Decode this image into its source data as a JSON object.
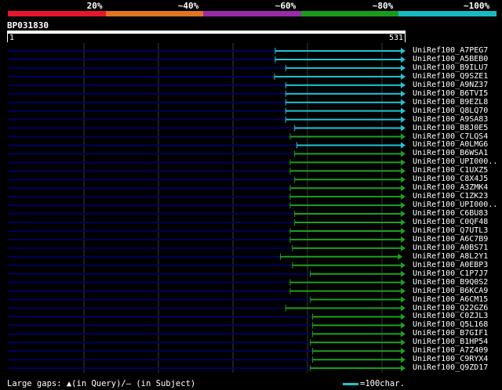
{
  "scale_legend": {
    "labels": [
      "20%",
      "~40%",
      "~60%",
      "~80%",
      "~100%"
    ],
    "colors": [
      "#e8162a",
      "#e07620",
      "#9a2aa8",
      "#1a9c1a",
      "#1ab8c4"
    ]
  },
  "query": {
    "name": "BP031830",
    "start": "1",
    "end": "531",
    "length": 531
  },
  "hits": [
    {
      "name": "UniRef100_A7PEG7",
      "start": 358,
      "end": 531,
      "color": "cyan",
      "kind": "arrow"
    },
    {
      "name": "UniRef100_A5BEB0",
      "start": 358,
      "end": 531,
      "color": "cyan",
      "kind": "arrow"
    },
    {
      "name": "UniRef100_B9ILU7",
      "start": 372,
      "end": 531,
      "color": "cyan",
      "kind": "arrow"
    },
    {
      "name": "UniRef100_Q9SZE1",
      "start": 357,
      "end": 531,
      "color": "cyan",
      "kind": "arrow"
    },
    {
      "name": "UniRef100_A9NZ37",
      "start": 372,
      "end": 531,
      "color": "cyan",
      "kind": "arrow"
    },
    {
      "name": "UniRef100_B6TVI5",
      "start": 372,
      "end": 531,
      "color": "cyan",
      "kind": "arrow"
    },
    {
      "name": "UniRef100_B9EZL8",
      "start": 372,
      "end": 531,
      "color": "cyan",
      "kind": "arrow"
    },
    {
      "name": "UniRef100_Q8LQ70",
      "start": 372,
      "end": 531,
      "color": "cyan",
      "kind": "arrow"
    },
    {
      "name": "UniRef100_A9SA83",
      "start": 372,
      "end": 531,
      "color": "cyan",
      "kind": "arrow"
    },
    {
      "name": "UniRef100_B8J0E5",
      "start": 384,
      "end": 531,
      "color": "cyan",
      "kind": "arrow"
    },
    {
      "name": "UniRef100_C7LQS4",
      "start": 378,
      "end": 531,
      "color": "green",
      "kind": "arrow"
    },
    {
      "name": "UniRef100_A0LMG6",
      "start": 387,
      "end": 531,
      "color": "cyan",
      "kind": "arrow"
    },
    {
      "name": "UniRef100_B6WSA1",
      "start": 384,
      "end": 531,
      "color": "green",
      "kind": "arrow"
    },
    {
      "name": "UniRef100_UPI000..",
      "start": 378,
      "end": 531,
      "color": "green",
      "kind": "arrow"
    },
    {
      "name": "UniRef100_C1UXZ5",
      "start": 378,
      "end": 531,
      "color": "green",
      "kind": "arrow"
    },
    {
      "name": "UniRef100_C8X4J5",
      "start": 384,
      "end": 531,
      "color": "green",
      "kind": "arrow"
    },
    {
      "name": "UniRef100_A3ZMK4",
      "start": 378,
      "end": 531,
      "color": "green",
      "kind": "arrow"
    },
    {
      "name": "UniRef100_C1ZK23",
      "start": 378,
      "end": 531,
      "color": "green",
      "kind": "arrow"
    },
    {
      "name": "UniRef100_UPI000..",
      "start": 378,
      "end": 531,
      "color": "green",
      "kind": "arrow"
    },
    {
      "name": "UniRef100_C6BU83",
      "start": 384,
      "end": 531,
      "color": "green",
      "kind": "arrow"
    },
    {
      "name": "UniRef100_C0QF48",
      "start": 384,
      "end": 531,
      "color": "green",
      "kind": "arrow"
    },
    {
      "name": "UniRef100_Q7UTL3",
      "start": 378,
      "end": 531,
      "color": "green",
      "kind": "arrow"
    },
    {
      "name": "UniRef100_A6C7B9",
      "start": 378,
      "end": 531,
      "color": "green",
      "kind": "arrow"
    },
    {
      "name": "UniRef100_A0BS71",
      "start": 381,
      "end": 531,
      "color": "green",
      "kind": "arrow"
    },
    {
      "name": "UniRef100_A8L2Y1",
      "start": 365,
      "end": 527,
      "color": "green",
      "kind": "arrow"
    },
    {
      "name": "UniRef100_A0EBP3",
      "start": 381,
      "end": 531,
      "color": "green",
      "kind": "arrow"
    },
    {
      "name": "UniRef100_C1P7J7",
      "start": 405,
      "end": 531,
      "color": "green",
      "kind": "arrow"
    },
    {
      "name": "UniRef100_B9Q0S2",
      "start": 378,
      "end": 531,
      "color": "green",
      "kind": "arrow"
    },
    {
      "name": "UniRef100_B6KCA9",
      "start": 378,
      "end": 531,
      "color": "green",
      "kind": "arrow"
    },
    {
      "name": "UniRef100_A6CM15",
      "start": 405,
      "end": 531,
      "color": "green",
      "kind": "arrow"
    },
    {
      "name": "UniRef100_Q22GZ6",
      "start": 372,
      "end": 531,
      "color": "green",
      "kind": "arrow"
    },
    {
      "name": "UniRef100_C0ZJL3",
      "start": 408,
      "end": 531,
      "color": "green",
      "kind": "arrow"
    },
    {
      "name": "UniRef100_Q5L168",
      "start": 408,
      "end": 531,
      "color": "green",
      "kind": "arrow"
    },
    {
      "name": "UniRef100_B7GIF1",
      "start": 408,
      "end": 531,
      "color": "green",
      "kind": "arrow"
    },
    {
      "name": "UniRef100_B1HP54",
      "start": 405,
      "end": 531,
      "color": "green",
      "kind": "arrow"
    },
    {
      "name": "UniRef100_A7Z409",
      "start": 408,
      "end": 531,
      "color": "green",
      "kind": "arrow"
    },
    {
      "name": "UniRef100_C9RYX4",
      "start": 408,
      "end": 531,
      "color": "green",
      "kind": "arrow"
    },
    {
      "name": "UniRef100_Q9ZD17",
      "start": 405,
      "end": 531,
      "color": "green",
      "kind": "arrow"
    }
  ],
  "hit_colors": {
    "cyan": "#22c4d4",
    "green": "#1ea01e",
    "unaligned": "#000060",
    "grid": "#3a3a3a"
  },
  "footer": {
    "gaps_text": "Large gaps: ▲(in Query)/— (in Subject)",
    "scale_text": "=100char."
  }
}
